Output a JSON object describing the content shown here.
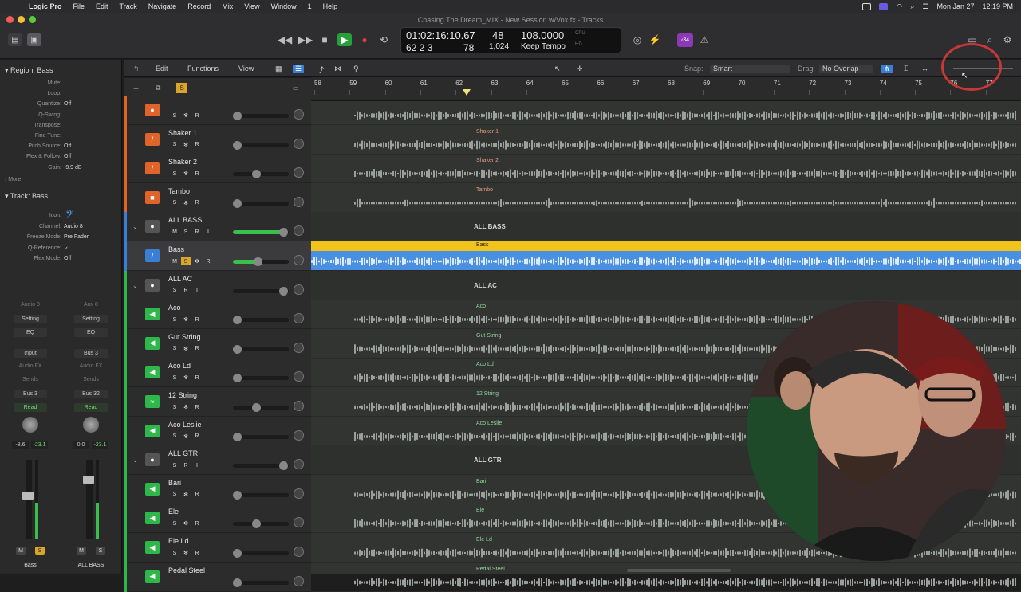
{
  "menubar": {
    "app": "Logic Pro",
    "items": [
      "File",
      "Edit",
      "Track",
      "Navigate",
      "Record",
      "Mix",
      "View",
      "Window",
      "1",
      "Help"
    ],
    "date": "Mon Jan 27",
    "time": "12:19 PM"
  },
  "window": {
    "title": "Chasing The Dream_MIX - New Session w/Vox fx - Tracks"
  },
  "lcd": {
    "timecode": "01:02:16:10.67",
    "bars": "62  2  3",
    "sub": "78",
    "sig_top": "48",
    "division": "1,024",
    "tempo": "108.0000",
    "tempo_mode": "Keep Tempo",
    "cpu_label": "CPU",
    "hd_label": "HD"
  },
  "badge": "‹34",
  "inspector": {
    "region_header": "Region: Bass",
    "region_rows": [
      {
        "k": "Mute:",
        "v": ""
      },
      {
        "k": "Loop:",
        "v": ""
      },
      {
        "k": "Quantize:",
        "v": "Off"
      },
      {
        "k": "Q-Swing:",
        "v": ""
      },
      {
        "k": "Transpose:",
        "v": ""
      },
      {
        "k": "Fine Tune:",
        "v": ""
      },
      {
        "k": "Pitch Source:",
        "v": "Off"
      },
      {
        "k": "Flex & Follow:",
        "v": "Off"
      },
      {
        "k": "Gain:",
        "v": "-9.9 dB"
      }
    ],
    "more": "More",
    "track_header": "Track: Bass",
    "track_rows": [
      {
        "k": "Icon:",
        "v": ""
      },
      {
        "k": "Channel:",
        "v": "Audio 8"
      },
      {
        "k": "Freeze Mode:",
        "v": "Pre Fader"
      },
      {
        "k": "Q-Reference:",
        "v": "✓"
      },
      {
        "k": "Flex Mode:",
        "v": "Off"
      }
    ],
    "strips": [
      {
        "top": "Audio 8",
        "setting": "Setting",
        "eq": "EQ",
        "input": "Input",
        "fx": "Audio FX",
        "sends": "Sends",
        "bus": "Bus 3",
        "auto": "Read",
        "vol": "-8.6",
        "peak": "-23.1",
        "name": "Bass"
      },
      {
        "top": "Aux 8",
        "setting": "Setting",
        "eq": "EQ",
        "input": "Bus 3",
        "fx": "Audio FX",
        "sends": "Sends",
        "bus": "Bus 32",
        "auto": "Read",
        "vol": "0.0",
        "peak": "-23.1",
        "name": "ALL BASS"
      }
    ]
  },
  "tracktools": {
    "edit": "Edit",
    "functions": "Functions",
    "view": "View",
    "snap_label": "Snap:",
    "snap_value": "Smart",
    "drag_label": "Drag:",
    "drag_value": "No Overlap"
  },
  "ruler": [
    "58",
    "59",
    "60",
    "61",
    "62",
    "63",
    "64",
    "65",
    "66",
    "67",
    "68",
    "69",
    "70",
    "71",
    "72",
    "73",
    "74",
    "75",
    "76",
    "77"
  ],
  "tracks": [
    {
      "name": "",
      "color": "#e0642a",
      "btns": "S ✻ R",
      "region": "",
      "kind": "audio",
      "icon": "●"
    },
    {
      "name": "Shaker 1",
      "color": "#e0642a",
      "btns": "S ✻ R",
      "region": "Shaker 1",
      "kind": "audio",
      "icon": "/"
    },
    {
      "name": "Shaker 2",
      "color": "#e0642a",
      "btns": "S ✻ R",
      "region": "Shaker 2",
      "kind": "audio",
      "icon": "/"
    },
    {
      "name": "Tambo",
      "color": "#e0642a",
      "btns": "S ✻ R",
      "region": "Tambo",
      "kind": "audio",
      "icon": "■"
    },
    {
      "name": "ALL BASS",
      "color": "#3a7fd6",
      "btns": "M S R I",
      "region": "ALL BASS",
      "kind": "folder",
      "icon": "●"
    },
    {
      "name": "Bass",
      "color": "#3a7fd6",
      "btns": "M S ✻ R",
      "region": "Bass",
      "kind": "selected",
      "icon": "/"
    },
    {
      "name": "ALL AC",
      "color": "#2fb84a",
      "btns": "S R I",
      "region": "ALL AC",
      "kind": "folder",
      "icon": "●"
    },
    {
      "name": "Aco",
      "color": "#2fb84a",
      "btns": "S ✻ R",
      "region": "Aco",
      "kind": "audio",
      "icon": "◀"
    },
    {
      "name": "Gut String",
      "color": "#2fb84a",
      "btns": "S ✻ R",
      "region": "Gut String",
      "kind": "audio",
      "icon": "◀"
    },
    {
      "name": "Aco Ld",
      "color": "#2fb84a",
      "btns": "S ✻ R",
      "region": "Aco Ld",
      "kind": "audio",
      "icon": "◀"
    },
    {
      "name": "12 String",
      "color": "#2fb84a",
      "btns": "S ✻ R",
      "region": "12 String",
      "kind": "audio",
      "icon": "≈"
    },
    {
      "name": "Aco Leslie",
      "color": "#2fb84a",
      "btns": "S ✻ R",
      "region": "Aco Leslie",
      "kind": "audio",
      "icon": "◀"
    },
    {
      "name": "ALL GTR",
      "color": "#2fb84a",
      "btns": "S R I",
      "region": "ALL GTR",
      "kind": "folder",
      "icon": "●"
    },
    {
      "name": "Bari",
      "color": "#2fb84a",
      "btns": "S ✻ R",
      "region": "Bari",
      "kind": "audio",
      "icon": "◀"
    },
    {
      "name": "Ele",
      "color": "#2fb84a",
      "btns": "S ✻ R",
      "region": "Ele",
      "kind": "audio",
      "icon": "◀"
    },
    {
      "name": "Ele Ld",
      "color": "#2fb84a",
      "btns": "S ✻ R",
      "region": "Ele Ld",
      "kind": "audio",
      "icon": "◀"
    },
    {
      "name": "Pedal Steel",
      "color": "#2fb84a",
      "btns": "",
      "region": "Pedal Steel",
      "kind": "audio",
      "icon": "◀"
    }
  ],
  "colors": {
    "accent": "#f2c31a",
    "selected_region": "#4a90e2",
    "play": "#27a03a"
  }
}
